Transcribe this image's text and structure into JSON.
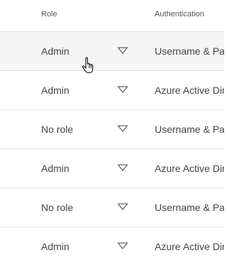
{
  "header": {
    "role": "Role",
    "authentication": "Authentication"
  },
  "rows": [
    {
      "role": "Admin",
      "authentication": "Username & Pas"
    },
    {
      "role": "Admin",
      "authentication": "Azure Active Dir"
    },
    {
      "role": "No role",
      "authentication": "Username & Pas"
    },
    {
      "role": "Admin",
      "authentication": "Azure Active Dir"
    },
    {
      "role": "No role",
      "authentication": "Username & Pas"
    },
    {
      "role": "Admin",
      "authentication": "Azure Active Dir"
    }
  ],
  "icons": {
    "dropdown": "chevron-down-icon",
    "cursor": "hand-pointer-icon"
  },
  "colors": {
    "hover_row": "#f5f5f5",
    "divider": "#e0e0e0",
    "text": "#444444"
  }
}
